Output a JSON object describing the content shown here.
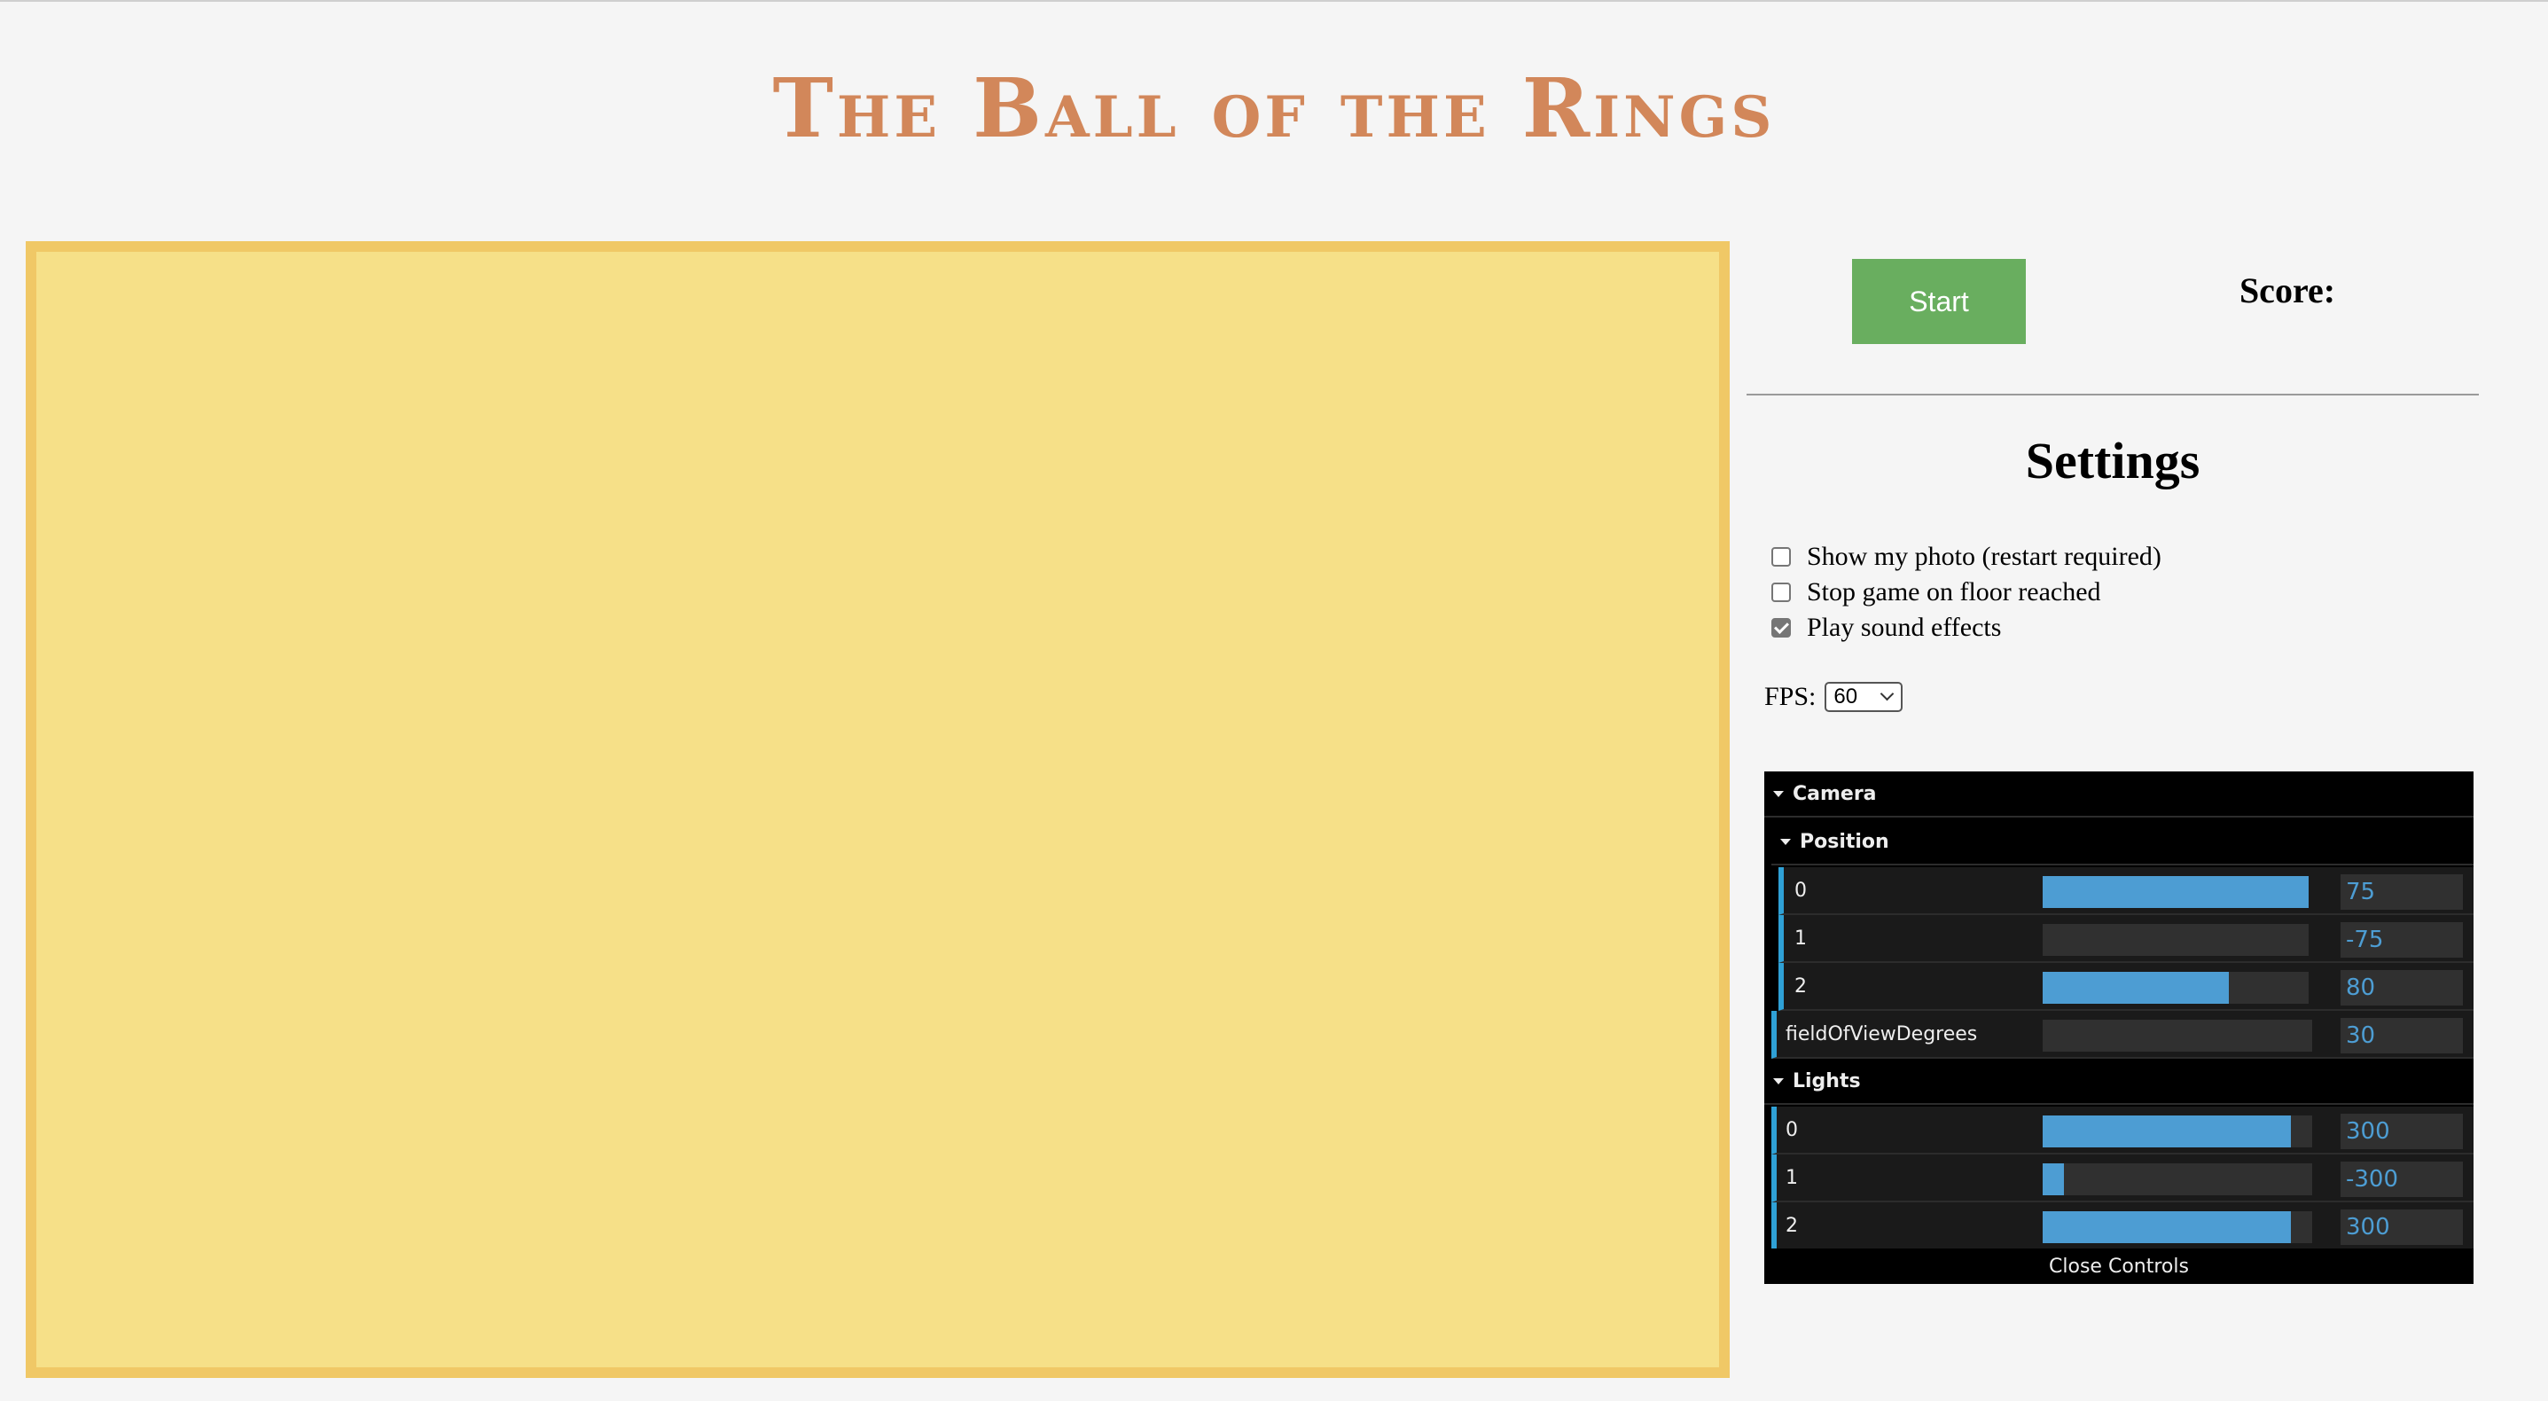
{
  "header": {
    "title": "The Ball of the Rings"
  },
  "controls": {
    "start_label": "Start",
    "score_label": "Score:"
  },
  "settings": {
    "heading": "Settings",
    "options": [
      {
        "label": "Show my photo (restart required)",
        "checked": false
      },
      {
        "label": "Stop game on floor reached",
        "checked": false
      },
      {
        "label": "Play sound effects",
        "checked": true
      }
    ],
    "fps_label": "FPS:",
    "fps_value": "60"
  },
  "gui": {
    "camera_label": "Camera",
    "position_label": "Position",
    "position": [
      {
        "label": "0",
        "value": "75",
        "fraction": 1.0
      },
      {
        "label": "1",
        "value": "-75",
        "fraction": 0.0
      },
      {
        "label": "2",
        "value": "80",
        "fraction": 0.7
      }
    ],
    "fov": {
      "label": "fieldOfViewDegrees",
      "value": "30",
      "fraction": 0.0
    },
    "lights_label": "Lights",
    "lights": [
      {
        "label": "0",
        "value": "300",
        "fraction": 0.92
      },
      {
        "label": "1",
        "value": "-300",
        "fraction": 0.08
      },
      {
        "label": "2",
        "value": "300",
        "fraction": 0.92
      }
    ],
    "close_label": "Close Controls"
  },
  "colors": {
    "title": "#d2875a",
    "canvas_fill": "#f6e088",
    "canvas_border": "#f0c866",
    "start_button": "#69ae5f",
    "slider_fill": "#4d9dd3",
    "gui_accent": "#2fa1d6"
  }
}
